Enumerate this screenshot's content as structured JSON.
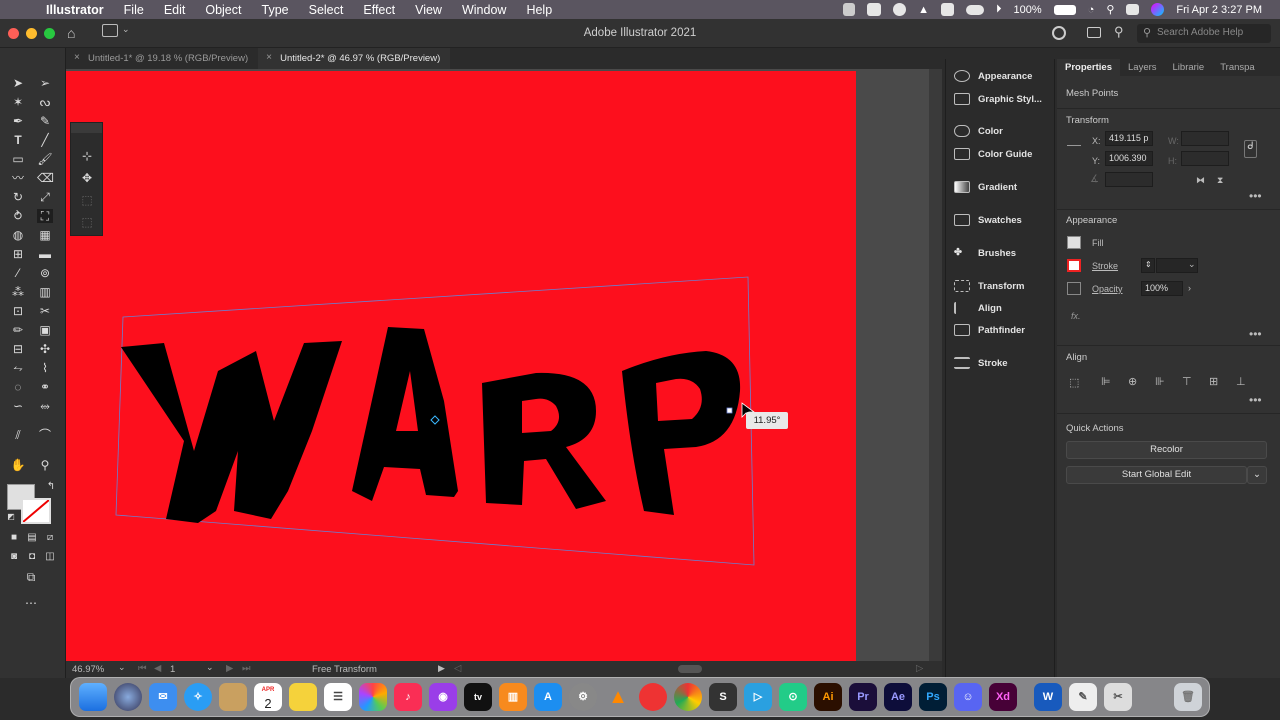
{
  "menubar": {
    "app": "Illustrator",
    "items": [
      "File",
      "Edit",
      "Object",
      "Type",
      "Select",
      "Effect",
      "View",
      "Window",
      "Help"
    ],
    "battery": "100%",
    "datetime": "Fri Apr 2  3:27 PM"
  },
  "titlebar": {
    "title": "Adobe Illustrator 2021",
    "search_placeholder": "Search Adobe Help"
  },
  "tabs": [
    {
      "label": "Untitled-1* @ 19.18 % (RGB/Preview)",
      "active": false
    },
    {
      "label": "Untitled-2* @ 46.97 % (RGB/Preview)",
      "active": true
    }
  ],
  "canvas": {
    "artboard_color": "#fd0f1d",
    "art_text": "WARP",
    "angle_tooltip": "11.95°"
  },
  "statusbar": {
    "zoom": "46.97%",
    "artboard": "1",
    "tool": "Free Transform"
  },
  "panels": {
    "items": [
      "Appearance",
      "Graphic Styl...",
      "Color",
      "Color Guide",
      "Gradient",
      "Swatches",
      "Brushes",
      "Transform",
      "Align",
      "Pathfinder",
      "Stroke"
    ]
  },
  "properties": {
    "tabs": [
      "Properties",
      "Layers",
      "Librarie",
      "Transpa"
    ],
    "selection": "Mesh Points",
    "transform": {
      "title": "Transform",
      "x_label": "X:",
      "x": "419.115 p",
      "y_label": "Y:",
      "y": "1006.390",
      "w_label": "W:",
      "h_label": "H:"
    },
    "appearance": {
      "title": "Appearance",
      "fill": "Fill",
      "stroke": "Stroke",
      "opacity_label": "Opacity",
      "opacity": "100%",
      "fx": "fx."
    },
    "align": {
      "title": "Align"
    },
    "quick_actions": {
      "title": "Quick Actions",
      "recolor": "Recolor",
      "global_edit": "Start Global Edit"
    }
  },
  "dock": {
    "calendar_month": "APR",
    "calendar_day": "2",
    "apps": [
      "Ai",
      "Pr",
      "Ae",
      "Ps",
      "Xd"
    ]
  }
}
